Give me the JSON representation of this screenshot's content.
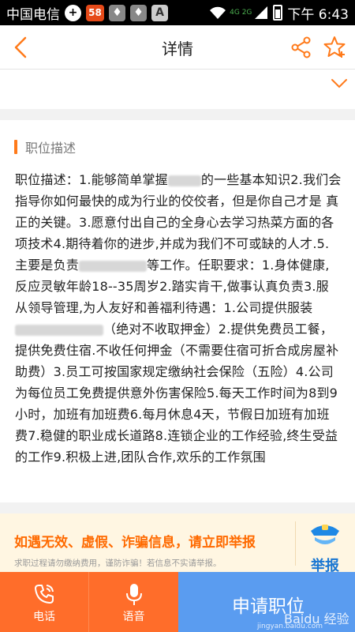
{
  "status_bar": {
    "carrier": "中国电信",
    "notif_badge": "58",
    "letter_badge": "A",
    "network": "4G 2G",
    "time": "下午 6:43"
  },
  "header": {
    "title": "详情"
  },
  "section": {
    "title": "职位描述"
  },
  "description": {
    "p1": "职位描述：1.能够简单掌握",
    "p2": "的一些基本知识2.我们会指导你如何最快的成为行业的佼佼者，但是你自己才是 真正的关键。3.愿意付出自己的全身心去学习热菜方面的各项技术4.期待着你的进步,并成为我们不可或缺的人才.5.主要是负责",
    "p3": "等工作。任职要求：1.身体健康,反应灵敏年龄18--35周岁2.踏实肯干,做事认真负责3.服从领导管理,为人友好和善福利待遇：1.公司提供服装",
    "p4": "（绝对不收取押金）2.提供免费员工餐，提供免费住宿.不收任何押金（不需要住宿可折合成房屋补助费）3.员工可按国家规定缴纳社会保险（五险）4.公司为每位员工免费提供意外伤害保险5.每天工作时间为8到9小时，加班有加班费6.每月休息4天，节假日加班有加班费7.稳健的职业成长道路8.连锁企业的工作经验,终生受益的工作9.积极上进,团队合作,欢乐的工作氛围"
  },
  "warning": {
    "title": "如遇无效、虚假、诈骗信息，请立即举报",
    "subtitle": "求职过程请勿缴纳费用，谨防诈骗！若信息不实请举报。",
    "report_label": "举报"
  },
  "bottom_bar": {
    "call_label": "电话",
    "voice_label": "语音",
    "apply_label": "申请职位",
    "watermark": "Baidu 经验",
    "watermark_url": "jingyan.baidu.com"
  },
  "colors": {
    "accent": "#ff7a1a",
    "apply_blue": "#5a9cf0",
    "report_blue": "#1976d2",
    "warning_bg": "#fff6e2"
  }
}
